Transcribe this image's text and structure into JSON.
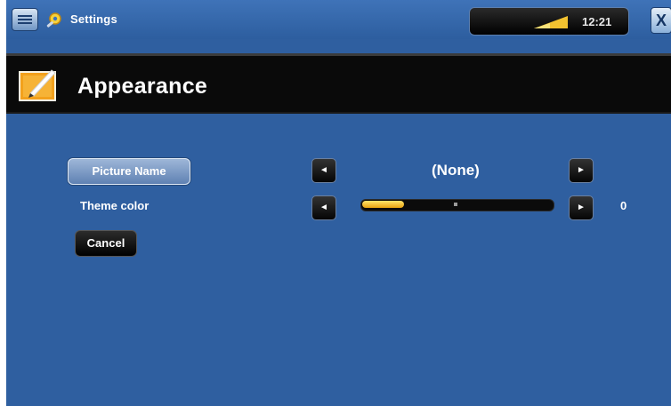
{
  "topbar": {
    "app_title": "Settings",
    "clock": "12:21",
    "close_glyph": "X",
    "battery_icon": "battery-signal-icon"
  },
  "header": {
    "title": "Appearance",
    "icon": "appearance-icon"
  },
  "rows": {
    "picture": {
      "button_label": "Picture Name",
      "value": "(None)",
      "left_arrow": "◄",
      "right_arrow": "►"
    },
    "theme": {
      "label": "Theme color",
      "value": "0",
      "slider_fraction": 0.22,
      "left_arrow": "◄",
      "right_arrow": "►"
    }
  },
  "cancel_label": "Cancel",
  "colors": {
    "background": "#2f5fa0",
    "header": "#0a0a0a",
    "slider_fill": "#f2c230"
  }
}
